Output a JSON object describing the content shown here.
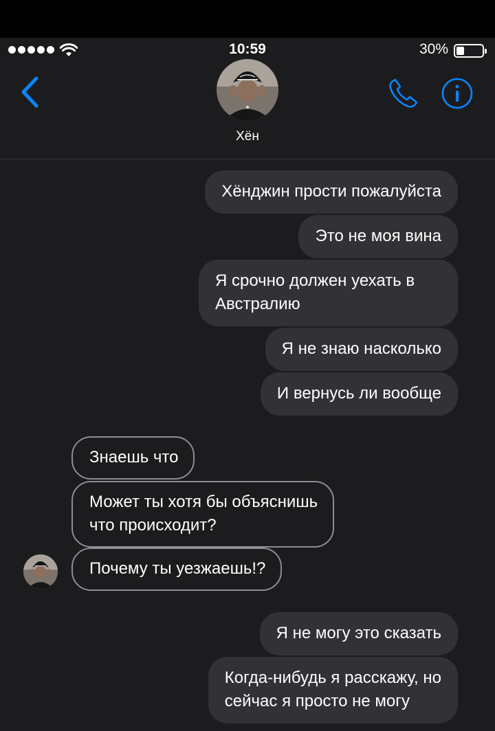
{
  "status_bar": {
    "time": "10:59",
    "battery_percent": "30%",
    "battery_level": 0.3
  },
  "header": {
    "contact_name": "Хён"
  },
  "colors": {
    "accent": "#0a84ff",
    "background": "#1c1c1e",
    "outgoing_bubble": "#323236",
    "incoming_border": "#8e8e93"
  },
  "messages": [
    {
      "direction": "outgoing",
      "lines": [
        "Хёнджин прости пожалуйста"
      ]
    },
    {
      "direction": "outgoing",
      "lines": [
        "Это не моя вина"
      ]
    },
    {
      "direction": "outgoing",
      "lines": [
        "Я срочно должен уехать в",
        "Австралию"
      ]
    },
    {
      "direction": "outgoing",
      "lines": [
        "Я не знаю насколько"
      ]
    },
    {
      "direction": "outgoing",
      "lines": [
        "И вернусь ли вообще"
      ]
    },
    {
      "direction": "incoming",
      "lines": [
        "Знаешь что"
      ]
    },
    {
      "direction": "incoming",
      "lines": [
        "Может ты хотя бы объяснишь",
        "что происходит?"
      ]
    },
    {
      "direction": "incoming",
      "lines": [
        "Почему ты уезжаешь!?"
      ]
    },
    {
      "direction": "outgoing",
      "lines": [
        "Я не могу это сказать"
      ]
    },
    {
      "direction": "outgoing",
      "lines": [
        "Когда-нибудь я расскажу, но",
        "сейчас я просто не могу"
      ]
    }
  ]
}
